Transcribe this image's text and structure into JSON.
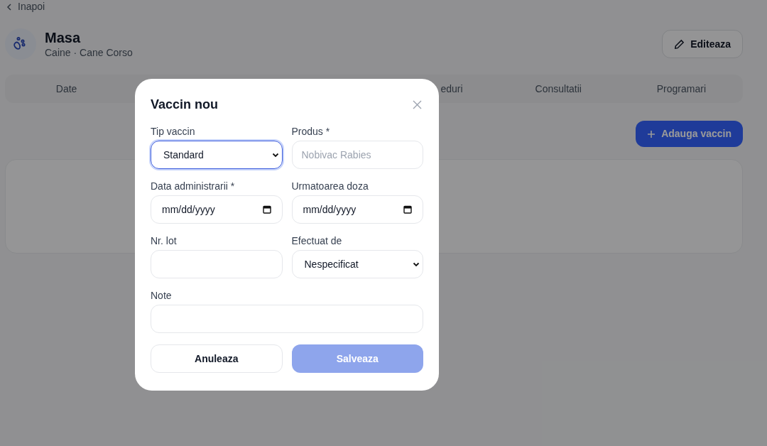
{
  "back_link": "Inapoi",
  "pet": {
    "name": "Masa",
    "subtitle": "Caine · Cane Corso"
  },
  "edit_button": "Editeaza",
  "tabs": [
    {
      "label": "Date",
      "kind": "full"
    },
    {
      "label": "eduri",
      "kind": "cut"
    },
    {
      "label": "Consultatii",
      "kind": "full"
    },
    {
      "label": "Programari",
      "kind": "full"
    }
  ],
  "add_button": "Adauga vaccin",
  "dialog": {
    "title": "Vaccin nou",
    "fields": [
      {
        "kind": "select",
        "label": "Tip vaccin",
        "value": "Standard",
        "focused": true
      },
      {
        "kind": "text",
        "label": "Produs *",
        "placeholder": "Nobivac Rabies",
        "focused": false
      },
      {
        "kind": "date",
        "label": "Data administrarii *",
        "value": "mm/dd/yyyy",
        "focused": false
      },
      {
        "kind": "date",
        "label": "Urmatoarea doza",
        "value": "mm/dd/yyyy",
        "focused": false
      },
      {
        "kind": "text",
        "label": "Nr. lot",
        "focused": false
      },
      {
        "kind": "select",
        "label": "Efectuat de",
        "value": "Nespecificat",
        "focused": false
      },
      {
        "kind": "text",
        "label": "Note",
        "wide": true,
        "focused": false
      }
    ],
    "cancel_button": "Anuleaza",
    "save_button": {
      "label": "Salveaza",
      "disabled": true
    }
  }
}
